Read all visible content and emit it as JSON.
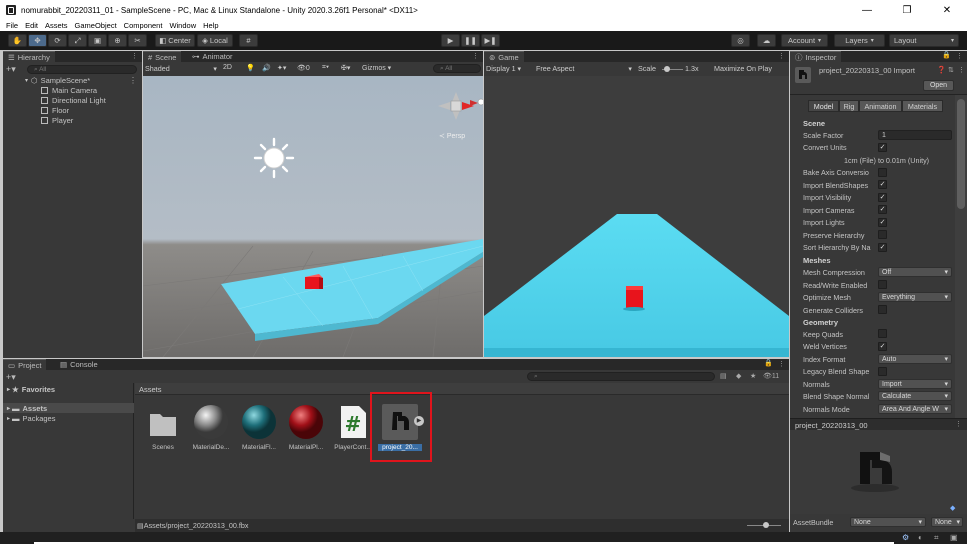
{
  "window": {
    "title": "nomurabbit_20220311_01 - SampleScene - PC, Mac & Linux Standalone - Unity 2020.3.26f1 Personal* <DX11>",
    "minimize": "—",
    "maximize": "❐",
    "close": "✕"
  },
  "menu": [
    "File",
    "Edit",
    "Assets",
    "GameObject",
    "Component",
    "Window",
    "Help"
  ],
  "toolbar": {
    "pivot_label": "Center",
    "space_label": "Local",
    "account_label": "Account",
    "layers_label": "Layers",
    "layout_label": "Layout"
  },
  "hierarchy": {
    "tab_label": "Hierarchy",
    "search_placeholder": "All",
    "scene_name": "SampleScene*",
    "objects": [
      "Main Camera",
      "Directional Light",
      "Floor",
      "Player"
    ]
  },
  "scene": {
    "tab_scene": "Scene",
    "tab_animator": "Animator",
    "shading_mode": "Shaded",
    "mode_2d": "2D",
    "gizmos_label": "Gizmos",
    "search_placeholder": "All",
    "persp_label": "Persp"
  },
  "game": {
    "tab_label": "Game",
    "display": "Display 1",
    "aspect": "Free Aspect",
    "scale_label": "Scale",
    "scale_value": "1.3x",
    "maximize_label": "Maximize On Play"
  },
  "project": {
    "tab_project": "Project",
    "tab_console": "Console",
    "favorites_label": "Favorites",
    "folders": [
      "Assets",
      "Packages"
    ],
    "breadcrumb": "Assets",
    "hidden_count": "11",
    "assets": [
      {
        "label": "Scenes"
      },
      {
        "label": "MaterialDe..."
      },
      {
        "label": "MaterialFl..."
      },
      {
        "label": "MaterialPl..."
      },
      {
        "label": "PlayerCont..."
      },
      {
        "label": "project_20..."
      }
    ],
    "status_path": "Assets/project_20220313_00.fbx"
  },
  "inspector": {
    "tab_label": "Inspector",
    "asset_title": "project_20220313_00 Import",
    "open_button": "Open",
    "tabs": [
      "Model",
      "Rig",
      "Animation",
      "Materials"
    ],
    "section_scene": "Scene",
    "scale_factor_label": "Scale Factor",
    "scale_factor_value": "1",
    "convert_units_label": "Convert Units",
    "convert_units_note": "1cm (File) to 0.01m (Unity)",
    "bake_axis_label": "Bake Axis Conversio",
    "import_blendshapes_label": "Import BlendShapes",
    "import_visibility_label": "Import Visibility",
    "import_cameras_label": "Import Cameras",
    "import_lights_label": "Import Lights",
    "preserve_hierarchy_label": "Preserve Hierarchy",
    "sort_hierarchy_label": "Sort Hierarchy By Na",
    "section_meshes": "Meshes",
    "mesh_compression_label": "Mesh Compression",
    "mesh_compression_value": "Off",
    "readwrite_label": "Read/Write Enabled",
    "optimize_mesh_label": "Optimize Mesh",
    "optimize_mesh_value": "Everything",
    "generate_colliders_label": "Generate Colliders",
    "section_geometry": "Geometry",
    "keep_quads_label": "Keep Quads",
    "weld_vertices_label": "Weld Vertices",
    "index_format_label": "Index Format",
    "index_format_value": "Auto",
    "legacy_blend_label": "Legacy Blend Shape",
    "normals_label": "Normals",
    "normals_value": "Import",
    "blend_normals_label": "Blend Shape Normal",
    "blend_normals_value": "Calculate",
    "normals_mode_label": "Normals Mode",
    "normals_mode_value": "Area And Angle W",
    "preview_title": "project_20220313_00",
    "assetbundle_label": "AssetBundle",
    "assetbundle_value": "None",
    "assetbundle_variant": "None"
  }
}
